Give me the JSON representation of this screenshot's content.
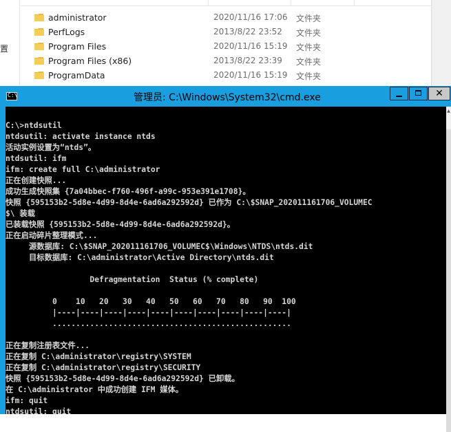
{
  "explorer": {
    "files": [
      {
        "name": "administrator",
        "date": "2020/11/16 17:06",
        "type": "文件夹"
      },
      {
        "name": "PerfLogs",
        "date": "2013/8/22 23:52",
        "type": "文件夹"
      },
      {
        "name": "Program Files",
        "date": "2020/11/16 15:19",
        "type": "文件夹"
      },
      {
        "name": "Program Files (x86)",
        "date": "2013/8/22 23:39",
        "type": "文件夹"
      },
      {
        "name": "ProgramData",
        "date": "2020/11/16 15:19",
        "type": "文件夹"
      }
    ],
    "left_glyph": "置",
    "folder_color": "#e8b93c"
  },
  "cmd": {
    "title": "管理员: C:\\Windows\\System32\\cmd.exe",
    "icon_text": "C:\\",
    "lines": [
      "C:\\>ntdsutil",
      "ntdsutil: activate instance ntds",
      "活动实例设置为“ntds”。",
      "ntdsutil: ifm",
      "ifm: create full C:\\administrator",
      "正在创建快照...",
      "成功生成快照集 {7a04bbec-f760-496f-a99c-953e391e1708}。",
      "快照 {595153b2-5d8e-4d99-8d4e-6ad6a292592d} 已作为 C:\\$SNAP_202011161706_VOLUMEC",
      "$\\ 装载",
      "已装载快照 {595153b2-5d8e-4d99-8d4e-6ad6a292592d}。",
      "正在启动碎片整理模式...",
      "     源数据库: C:\\$SNAP_202011161706_VOLUMEC$\\Windows\\NTDS\\ntds.dit",
      "     目标数据库: C:\\administrator\\Active Directory\\ntds.dit",
      "",
      "                  Defragmentation  Status (% complete)",
      "",
      "          0    10   20   30   40   50   60   70   80   90  100",
      "          |----|----|----|----|----|----|----|----|----|----|",
      "          ...................................................",
      "",
      "正在复制注册表文件...",
      "正在复制 C:\\administrator\\registry\\SYSTEM",
      "正在复制 C:\\administrator\\registry\\SECURITY",
      "快照 {595153b2-5d8e-4d99-8d4e-6ad6a292592d} 已卸载。",
      "在 C:\\administrator 中成功创建 IFM 媒体。",
      "ifm: quit",
      "ntdsutil: quit"
    ],
    "colors": {
      "frame": "#199ee0",
      "console_bg": "#000000",
      "console_text": "#d6d6d6"
    }
  }
}
